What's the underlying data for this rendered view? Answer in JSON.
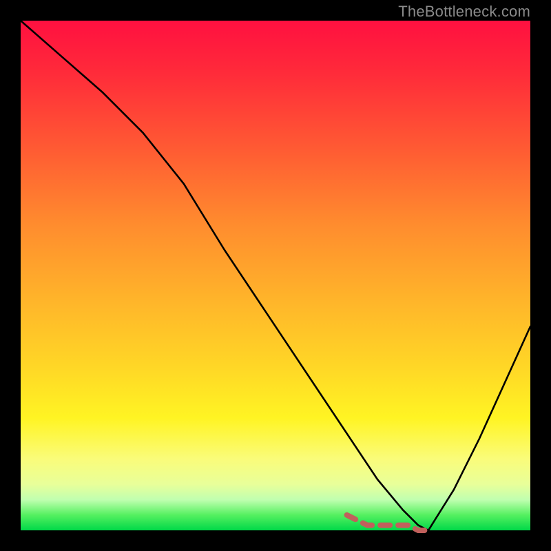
{
  "watermark": "TheBottleneck.com",
  "colors": {
    "frame": "#000000",
    "curve": "#000000",
    "dash": "#c1605c",
    "gradient_top": "#ff1040",
    "gradient_bottom": "#00d848"
  },
  "chart_data": {
    "type": "line",
    "title": "",
    "xlabel": "",
    "ylabel": "",
    "xlim": [
      0,
      100
    ],
    "ylim": [
      0,
      100
    ],
    "grid": false,
    "series": [
      {
        "name": "bottleneck-curve",
        "x": [
          0,
          8,
          16,
          24,
          32,
          40,
          48,
          56,
          64,
          70,
          75,
          78,
          80,
          85,
          90,
          95,
          100
        ],
        "y": [
          100,
          93,
          86,
          78,
          68,
          55,
          43,
          31,
          19,
          10,
          4,
          1,
          0,
          8,
          18,
          29,
          40
        ]
      }
    ],
    "annotations": [
      {
        "name": "dashed-min-marker",
        "style": "dashed",
        "x": [
          64,
          66,
          68,
          70,
          72,
          74,
          76,
          78,
          80
        ],
        "y": [
          3,
          2,
          1,
          1,
          1,
          1,
          1,
          0,
          0
        ]
      }
    ]
  }
}
